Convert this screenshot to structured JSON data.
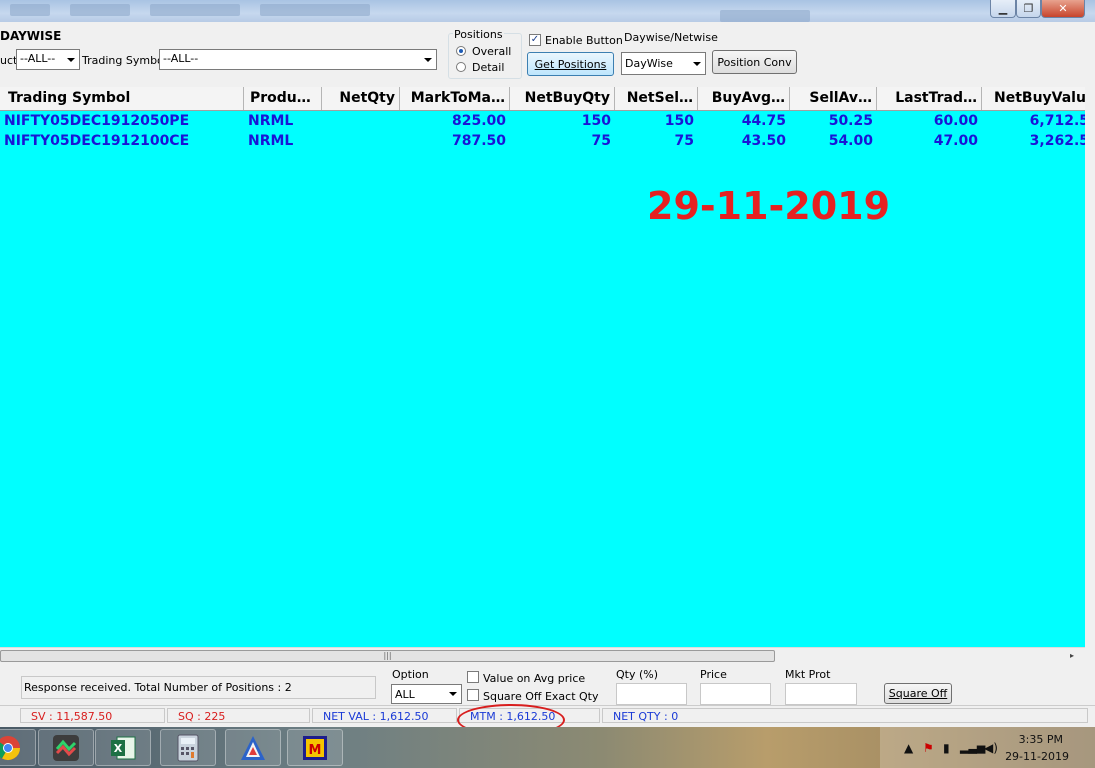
{
  "window": {
    "minimize": "▁",
    "maximize": "❐",
    "close": "✕"
  },
  "filters": {
    "view_title": "DAYWISE",
    "product_label": "uct",
    "product_value": "--ALL--",
    "trading_symbol_label": "Trading Symbol",
    "trading_symbol_value": "--ALL--",
    "positions_group_label": "Positions",
    "positions_options": [
      "Overall",
      "Detail"
    ],
    "positions_selected": "Overall",
    "enable_button_label": "Enable Button",
    "enable_button_checked": true,
    "get_positions_label": "Get Positions",
    "daywise_netwise_label": "Daywise/Netwise",
    "daywise_netwise_value": "DayWise",
    "position_conv_label": "Position Conv"
  },
  "grid": {
    "background": "#00ffff",
    "columns": [
      "Trading Symbol",
      "Produ…",
      "NetQty",
      "MarkToMa…",
      "NetBuyQty",
      "NetSel…",
      "BuyAvg…",
      "SellAv…",
      "LastTrad…",
      "NetBuyValu"
    ],
    "rows": [
      [
        "NIFTY05DEC1912050PE",
        "NRML",
        "",
        "825.00",
        "150",
        "150",
        "44.75",
        "50.25",
        "60.00",
        "6,712.5"
      ],
      [
        "NIFTY05DEC1912100CE",
        "NRML",
        "",
        "787.50",
        "75",
        "75",
        "43.50",
        "54.00",
        "47.00",
        "3,262.5"
      ]
    ],
    "annotation_date": "29-11-2019"
  },
  "scroll": {
    "thumb_grip": "|||",
    "right_arrow": "▸"
  },
  "order_panel": {
    "response_text": "Response received. Total Number of Positions : 2",
    "option_label": "Option",
    "option_value": "ALL",
    "value_on_avg_label": "Value on Avg  price",
    "square_off_exact_label": "Square Off Exact Qty",
    "qty_label": "Qty (%)",
    "price_label": "Price",
    "mkt_prot_label": "Mkt Prot",
    "square_off_label": "Square Off"
  },
  "statusbar": {
    "sv": "SV : 11,587.50",
    "sq": "SQ : 225",
    "net_val": "NET VAL : 1,612.50",
    "mtm": "MTM : 1,612.50",
    "net_qty": "NET QTY : 0",
    "colors": {
      "red": "#d81e1e",
      "blue": "#1a3ad6"
    }
  },
  "taskbar": {
    "apps": [
      "chrome-icon",
      "trading-terminal-icon",
      "excel-icon",
      "calculator-icon",
      "amibroker-icon",
      "odin-icon"
    ],
    "time": "3:35 PM",
    "date": "29-11-2019"
  }
}
